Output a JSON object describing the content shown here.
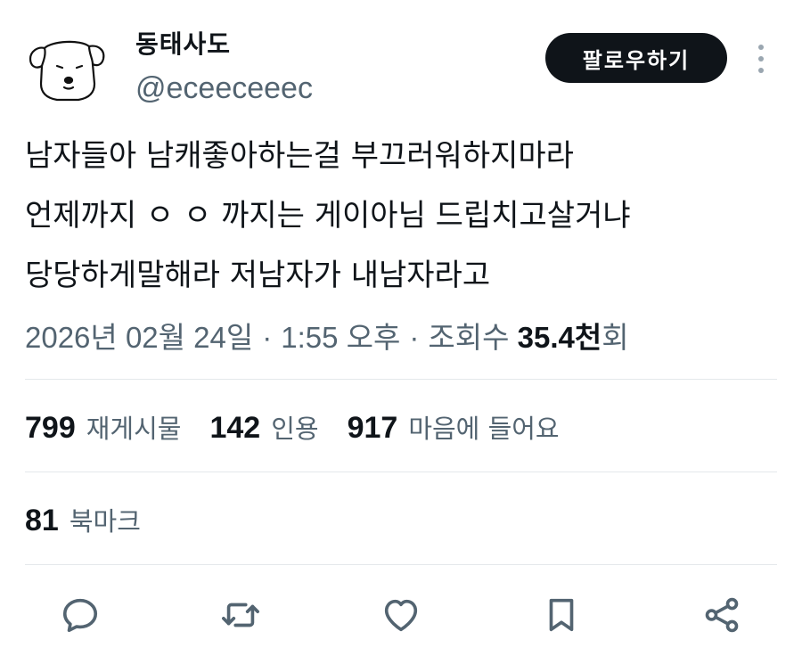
{
  "user": {
    "display_name": "동태사도",
    "handle": "@eceeceeec"
  },
  "follow_button_label": "팔로우하기",
  "more_icon": "more-vertical-icon",
  "tweet": {
    "lines": [
      "남자들아 남캐좋아하는걸 부끄러워하지마라",
      "언제까지 ㅇ ㅇ 까지는 게이아님 드립치고살거냐",
      "당당하게말해라 저남자가 내남자라고"
    ]
  },
  "meta": {
    "date": "2026년 02월 24일",
    "separator": "·",
    "time": "1:55 오후",
    "views_prefix": "조회수",
    "views_count": "35.4천",
    "views_suffix": "회"
  },
  "stats": {
    "retweets": {
      "count": "799",
      "label": "재게시물"
    },
    "quotes": {
      "count": "142",
      "label": "인용"
    },
    "likes": {
      "count": "917",
      "label": "마음에 들어요"
    },
    "bookmarks": {
      "count": "81",
      "label": "북마크"
    }
  },
  "actions": [
    "reply-icon",
    "retweet-icon",
    "like-icon",
    "bookmark-icon",
    "share-icon"
  ],
  "colors": {
    "text": "#0f1419",
    "secondary": "#536471",
    "divider": "#e4e8eb",
    "button_bg": "#0f1419",
    "button_text": "#ffffff"
  }
}
